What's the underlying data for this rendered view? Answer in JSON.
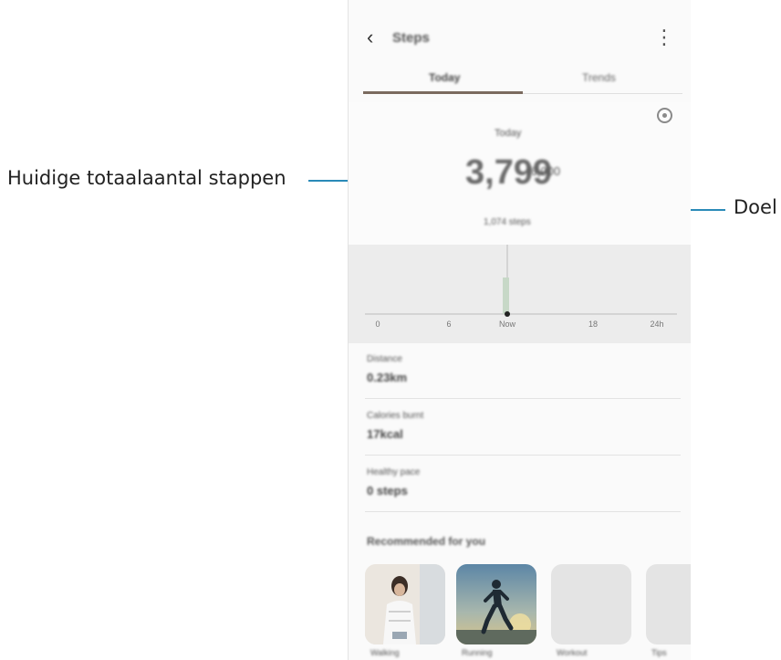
{
  "callouts": {
    "current_steps": "Huidige totaalaantal stappen",
    "target": "Doel"
  },
  "app": {
    "header": {
      "title": "Steps",
      "back_icon": "chevron-left-icon",
      "more_icon": "more-vertical-icon"
    },
    "tabs": [
      {
        "label": "Today",
        "selected": true
      },
      {
        "label": "Trends",
        "selected": false
      }
    ],
    "summary": {
      "label": "Today",
      "count": "3,799",
      "target": "/6,000",
      "sub": "1,074 steps"
    },
    "chart": {
      "x_labels": [
        "0",
        "6",
        "Now",
        "18",
        "24h"
      ]
    },
    "stats": [
      {
        "label": "Distance",
        "value": "0.23km"
      },
      {
        "label": "Calories burnt",
        "value": "17kcal"
      },
      {
        "label": "Healthy pace",
        "value": "0 steps"
      }
    ],
    "recommended": {
      "title": "Recommended for you",
      "captions": [
        "Walking",
        "Running",
        "Workout",
        "Tips"
      ]
    },
    "colors": {
      "accent": "#7a6a5e",
      "chart_bar": "#c7d8c7",
      "callout_line": "#2a8ab8"
    }
  }
}
